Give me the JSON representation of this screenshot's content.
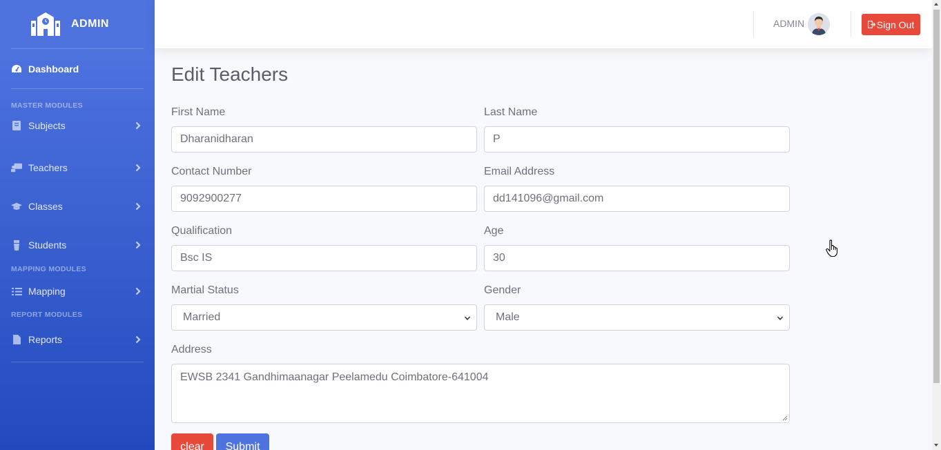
{
  "brand": {
    "title": "ADMIN"
  },
  "sidebar": {
    "dashboard": "Dashboard",
    "sections": {
      "master": "MASTER MODULES",
      "mapping": "MAPPING MODULES",
      "report": "REPORT MODULES"
    },
    "items": {
      "subjects": "Subjects",
      "teachers": "Teachers",
      "classes": "Classes",
      "students": "Students",
      "mapping": "Mapping",
      "reports": "Reports"
    }
  },
  "topbar": {
    "user": "ADMIN",
    "signout": "Sign Out"
  },
  "page": {
    "title": "Edit Teachers"
  },
  "form": {
    "first_name": {
      "label": "First Name",
      "value": "Dharanidharan"
    },
    "last_name": {
      "label": "Last Name",
      "value": "P"
    },
    "contact": {
      "label": "Contact Number",
      "value": "9092900277"
    },
    "email": {
      "label": "Email Address",
      "value": "dd141096@gmail.com"
    },
    "qualification": {
      "label": "Qualification",
      "value": "Bsc IS"
    },
    "age": {
      "label": "Age",
      "value": "30"
    },
    "marital": {
      "label": "Martial Status",
      "value": "Married"
    },
    "gender": {
      "label": "Gender",
      "value": "Male"
    },
    "address": {
      "label": "Address",
      "value": "EWSB 2341 Gandhimaanagar Peelamedu Coimbatore-641004"
    },
    "clear": "clear",
    "submit": "Submit"
  },
  "colors": {
    "sidebar_start": "#4e73df",
    "sidebar_end": "#224abe",
    "danger": "#e74a3b",
    "primary": "#4e73df"
  }
}
